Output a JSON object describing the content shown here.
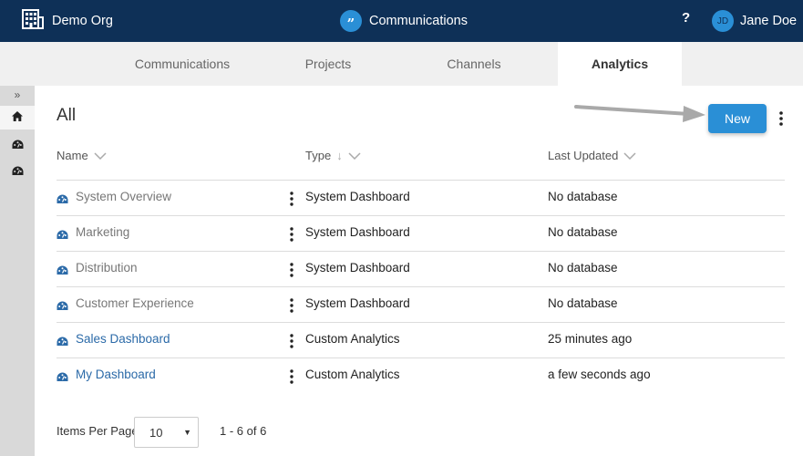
{
  "header": {
    "org_name": "Demo Org",
    "org_icon": "building-icon",
    "app_name": "Communications",
    "app_icon": "quote-icon",
    "help_label": "?",
    "user_initials": "JD",
    "user_name": "Jane Doe"
  },
  "tabs": [
    {
      "label": "Communications",
      "active": false
    },
    {
      "label": "Projects",
      "active": false
    },
    {
      "label": "Channels",
      "active": false
    },
    {
      "label": "Analytics",
      "active": true
    }
  ],
  "sidebar": {
    "expand_label": "»",
    "items": [
      "home-icon",
      "dashboard-icon",
      "dashboard-icon"
    ]
  },
  "main": {
    "title": "All",
    "new_button": "New",
    "columns": [
      "Name",
      "Type",
      "Last Updated"
    ],
    "rows": [
      {
        "name": "System Overview",
        "type": "System Dashboard",
        "updated": "No database",
        "link": false
      },
      {
        "name": "Marketing",
        "type": "System Dashboard",
        "updated": "No database",
        "link": false
      },
      {
        "name": "Distribution",
        "type": "System Dashboard",
        "updated": "No database",
        "link": false
      },
      {
        "name": "Customer Experience",
        "type": "System Dashboard",
        "updated": "No database",
        "link": false
      },
      {
        "name": "Sales Dashboard",
        "type": "Custom Analytics",
        "updated": "25 minutes ago",
        "link": true
      },
      {
        "name": "My Dashboard",
        "type": "Custom Analytics",
        "updated": "a few seconds ago",
        "link": true
      }
    ]
  },
  "pagination": {
    "items_per_page_label": "Items Per Page",
    "items_per_page_value": "10",
    "range": "1 - 6 of 6"
  },
  "colors": {
    "topbar": "#0e3057",
    "accent": "#2a8fd6",
    "link": "#2b6aa8"
  }
}
